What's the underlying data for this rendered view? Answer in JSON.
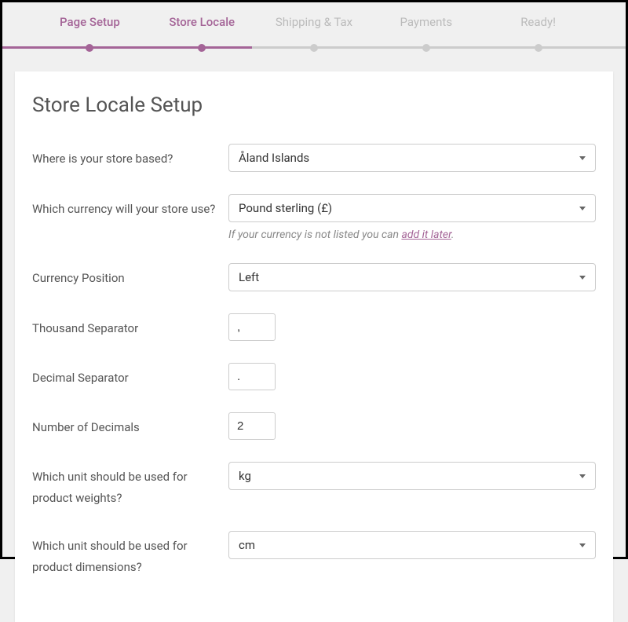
{
  "steps": {
    "page_setup": "Page Setup",
    "store_locale": "Store Locale",
    "shipping_tax": "Shipping & Tax",
    "payments": "Payments",
    "ready": "Ready!"
  },
  "title": "Store Locale Setup",
  "fields": {
    "country": {
      "label": "Where is your store based?",
      "value": "Åland Islands"
    },
    "currency": {
      "label": "Which currency will your store use?",
      "value": "Pound sterling (£)",
      "hint_prefix": "If your currency is not listed you can ",
      "hint_link": "add it later",
      "hint_suffix": "."
    },
    "currency_position": {
      "label": "Currency Position",
      "value": "Left"
    },
    "thousand_sep": {
      "label": "Thousand Separator",
      "value": ","
    },
    "decimal_sep": {
      "label": "Decimal Separator",
      "value": "."
    },
    "num_decimals": {
      "label": "Number of Decimals",
      "value": "2"
    },
    "weight_unit": {
      "label": "Which unit should be used for product weights?",
      "value": "kg"
    },
    "dimension_unit": {
      "label": "Which unit should be used for product dimensions?",
      "value": "cm"
    }
  }
}
